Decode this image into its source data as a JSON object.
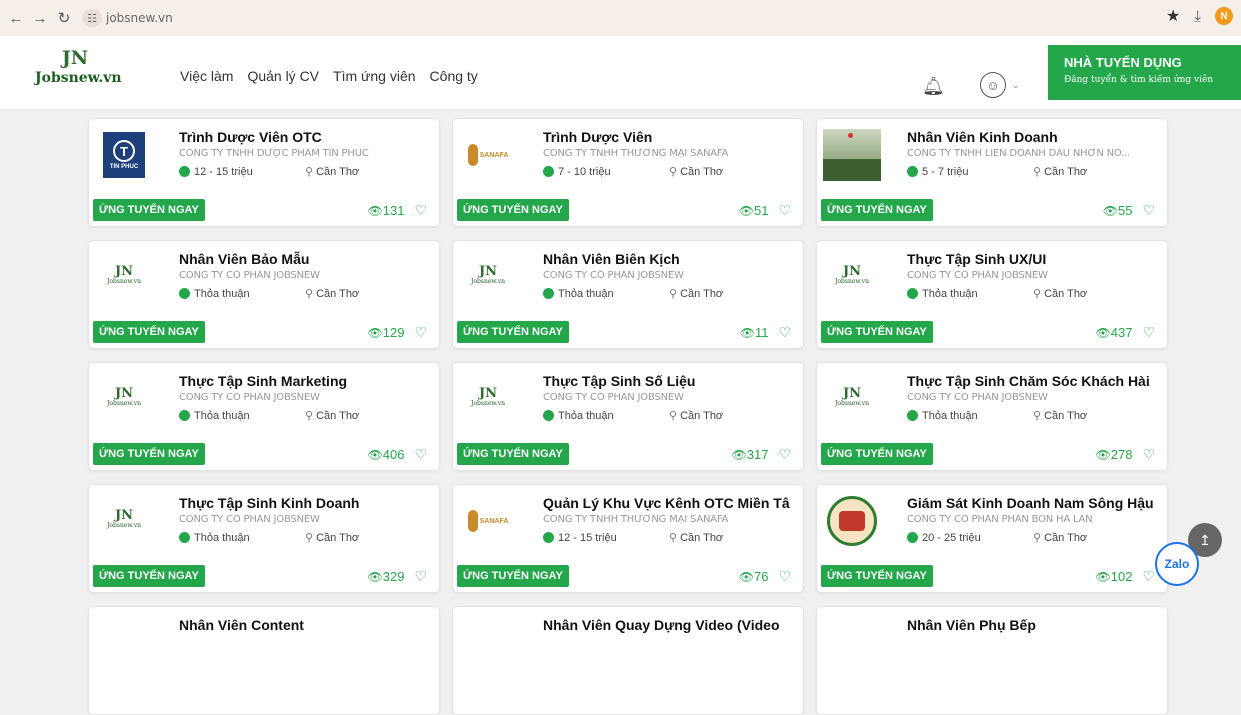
{
  "browser": {
    "url": "jobsnew.vn",
    "profile_initial": "N",
    "nav_icons": [
      "back-arrow",
      "forward-arrow",
      "reload",
      "site-info"
    ]
  },
  "site": {
    "logo_mark": "JN",
    "logo_name": "Jobsnew.vn",
    "menu": [
      "Việc làm",
      "Quản lý CV",
      "Tìm ứng viên",
      "Công ty"
    ],
    "employer_title": "NHÀ TUYỂN DỤNG",
    "employer_sub": "Đăng tuyển & tìm kiếm ứng viên"
  },
  "apply_label": "ỨNG TUYỂN NGAY",
  "jobs": [
    {
      "title": "Trình Dược Viên OTC",
      "company": "CÔNG TY TNHH DƯỢC PHẨM TÍN PHÚC",
      "salary": "12 - 15 triệu",
      "location": "Cần Thơ",
      "views": "131",
      "logo": "tin-phuc"
    },
    {
      "title": "Trình Dược Viên",
      "company": "CÔNG TY TNHH THƯƠNG MẠI SANAFA",
      "salary": "7 - 10 triệu",
      "location": "Cần Thơ",
      "views": "51",
      "logo": "sanafa"
    },
    {
      "title": "Nhân Viên Kinh Doanh",
      "company": "CÔNG TY TNHH LIÊN DOANH DẦU NHỜN NO...",
      "salary": "5 - 7 triệu",
      "location": "Cần Thơ",
      "views": "55",
      "logo": "photo"
    },
    {
      "title": "Nhân Viên Bảo Mẫu",
      "company": "CÔNG TY CỔ PHẦN JOBSNEW",
      "salary": "Thỏa thuận",
      "location": "Cần Thơ",
      "views": "129",
      "logo": "jobsnew"
    },
    {
      "title": "Nhân Viên Biên Kịch",
      "company": "CÔNG TY CỔ PHẦN JOBSNEW",
      "salary": "Thỏa thuận",
      "location": "Cần Thơ",
      "views": "11",
      "logo": "jobsnew"
    },
    {
      "title": "Thực Tập Sinh UX/UI",
      "company": "CÔNG TY CỔ PHẦN JOBSNEW",
      "salary": "Thỏa thuận",
      "location": "Cần Thơ",
      "views": "437",
      "logo": "jobsnew"
    },
    {
      "title": "Thực Tập Sinh Marketing",
      "company": "CÔNG TY CỔ PHẦN JOBSNEW",
      "salary": "Thỏa thuận",
      "location": "Cần Thơ",
      "views": "406",
      "logo": "jobsnew"
    },
    {
      "title": "Thực Tập Sinh Số Liệu",
      "company": "CÔNG TY CỔ PHẦN JOBSNEW",
      "salary": "Thỏa thuận",
      "location": "Cần Thơ",
      "views": "317",
      "logo": "jobsnew"
    },
    {
      "title": "Thực Tập Sinh Chăm Sóc Khách Hài",
      "company": "CÔNG TY CỔ PHẦN JOBSNEW",
      "salary": "Thỏa thuận",
      "location": "Cần Thơ",
      "views": "278",
      "logo": "jobsnew"
    },
    {
      "title": "Thực Tập Sinh Kinh Doanh",
      "company": "CÔNG TY CỔ PHẦN JOBSNEW",
      "salary": "Thỏa thuận",
      "location": "Cần Thơ",
      "views": "329",
      "logo": "jobsnew"
    },
    {
      "title": "Quản Lý Khu Vực Kênh OTC Miền Tâ",
      "company": "CÔNG TY TNHH THƯƠNG MẠI SANAFA",
      "salary": "12 - 15 triệu",
      "location": "Cần Thơ",
      "views": "76",
      "logo": "sanafa"
    },
    {
      "title": "Giám Sát Kinh Doanh Nam Sông Hậu",
      "company": "CÔNG TY CỔ PHẦN PHÂN BÓN HÀ LAN",
      "salary": "20 - 25 triệu",
      "location": "Cần Thơ",
      "views": "102",
      "logo": "halan"
    },
    {
      "title": "Nhân Viên Content",
      "company": "",
      "salary": "",
      "location": "",
      "views": "",
      "logo": "none"
    },
    {
      "title": "Nhân Viên Quay Dựng Video (Video",
      "company": "",
      "salary": "",
      "location": "",
      "views": "",
      "logo": "none"
    },
    {
      "title": "Nhân Viên Phụ Bếp",
      "company": "",
      "salary": "",
      "location": "",
      "views": "",
      "logo": "none"
    }
  ],
  "logo_text": {
    "tin_phuc": "TIN PHUC",
    "sanafa": "SANAFA",
    "jobsnew_mark": "JN",
    "jobsnew_name": "Jobsnew.vn"
  },
  "zalo": "Zalo",
  "colors": {
    "accent": "#23a74a",
    "brand_red": "#e0332f"
  }
}
